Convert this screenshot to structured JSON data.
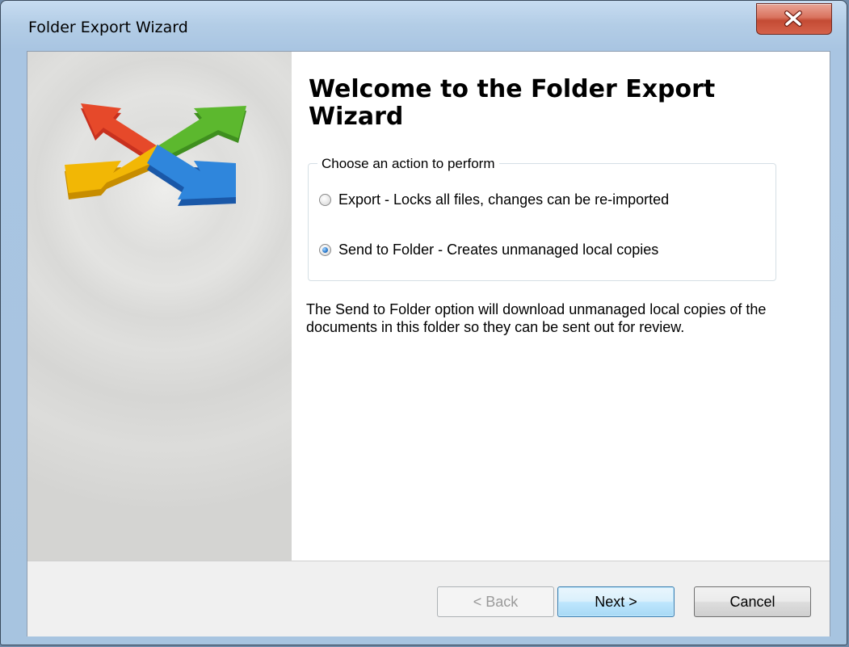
{
  "window": {
    "title": "Folder Export Wizard"
  },
  "wizard": {
    "heading": "Welcome to the Folder Export Wizard",
    "group_label": "Choose an action to perform",
    "options": [
      {
        "label": "Export - Locks all files, changes can be re-imported",
        "selected": false
      },
      {
        "label": "Send to Folder - Creates unmanaged local copies",
        "selected": true
      }
    ],
    "description": "The Send to Folder option will download unmanaged local copies of the documents in this folder so they can be sent out for review."
  },
  "buttons": {
    "back": "< Back",
    "next": "Next >",
    "cancel": "Cancel"
  },
  "colors": {
    "accent_blue": "#2f7fd0",
    "close_red": "#c44b34"
  },
  "icons": {
    "wizard_logo": "four-direction-arrows-icon",
    "close": "close-icon"
  }
}
